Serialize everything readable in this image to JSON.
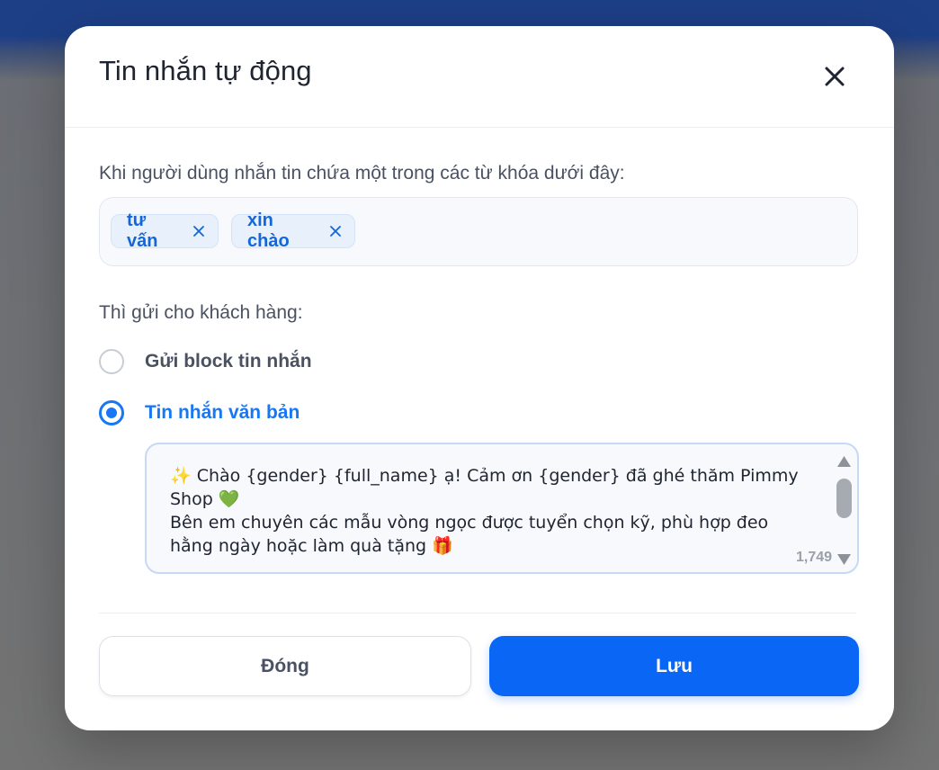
{
  "modal": {
    "title": "Tin nhắn tự động",
    "close_icon": "close-icon"
  },
  "keywords": {
    "label": "Khi người dùng nhắn tin chứa một trong các từ khóa dưới đây:",
    "chips": [
      {
        "text": "tư vấn"
      },
      {
        "text": "xin chào"
      }
    ]
  },
  "send": {
    "label": "Thì gửi cho khách hàng:",
    "options": [
      {
        "label": "Gửi block tin nhắn",
        "selected": false
      },
      {
        "label": "Tin nhắn văn bản",
        "selected": true
      }
    ]
  },
  "message": {
    "value": "✨ Chào {gender} {full_name} ạ! Cảm ơn {gender} đã ghé thăm Pimmy Shop 💚\nBên em chuyên các mẫu vòng ngọc được tuyển chọn kỹ, phù hợp đeo hằng ngày hoặc làm quà tặng 🎁",
    "char_count": "1,749"
  },
  "footer": {
    "close_label": "Đóng",
    "save_label": "Lưu"
  },
  "colors": {
    "accent": "#1877f2",
    "save_button": "#0a66f5"
  }
}
